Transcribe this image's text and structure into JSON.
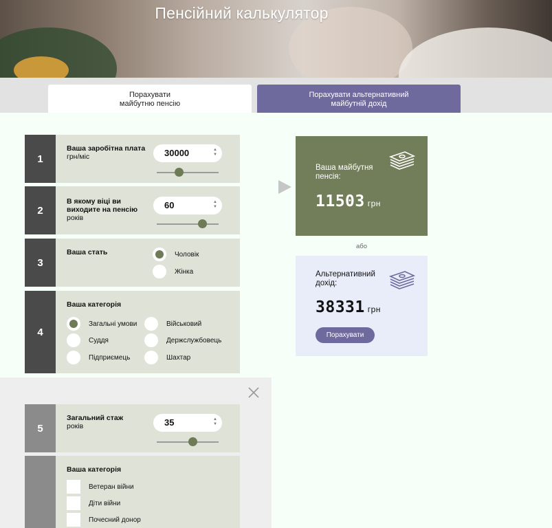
{
  "header": {
    "title": "Пенсійний калькулятор"
  },
  "tabs": [
    {
      "line1": "Порахувати",
      "line2": "майбутню пенсію"
    },
    {
      "line1": "Порахувати альтернативний",
      "line2": "майбутній дохід"
    }
  ],
  "rows": {
    "r1": {
      "num": "1",
      "label_bold": "Ваша заробітна плата",
      "label_rest": "грн/міс",
      "value": "30000",
      "slider_fraction": 0.36
    },
    "r2": {
      "num": "2",
      "label_bold": "В якому віці ви виходите на пенсію",
      "label_rest": "років",
      "value": "60",
      "slider_fraction": 0.74
    },
    "r3": {
      "num": "3",
      "label_bold": "Ваша стать",
      "options": [
        "Чоловік",
        "Жінка"
      ],
      "selected": "Чоловік"
    },
    "r4": {
      "num": "4",
      "label_bold": "Ваша категорія",
      "options": [
        "Загальні умови",
        "Військовий",
        "Суддя",
        "Держслужбовець",
        "Підприємець",
        "Шахтар"
      ],
      "selected": "Загальні умови"
    },
    "r5": {
      "num": "5",
      "label_bold": "Загальний стаж",
      "label_rest": "років",
      "value": "35",
      "slider_fraction": 0.58
    },
    "r6": {
      "label_bold": "Ваша категорія",
      "options": [
        "Ветеран війни",
        "Діти війни",
        "Почесний донор"
      ]
    }
  },
  "result_main": {
    "label": "Ваша майбутня пенсія:",
    "value": "11503",
    "unit": "грн"
  },
  "or_text": "або",
  "result_alt": {
    "label": "Альтернативний дохід:",
    "value": "38331",
    "unit": "грн",
    "button": "Порахувати"
  },
  "colors": {
    "accent_green": "#727d5a",
    "accent_purple": "#6e6a9e",
    "row_bg": "#dfe3d7",
    "num_bg": "#4a4a4a"
  },
  "icons": {
    "money": "money-stack-icon",
    "close": "close-icon",
    "arrow": "triangle-right-icon"
  }
}
